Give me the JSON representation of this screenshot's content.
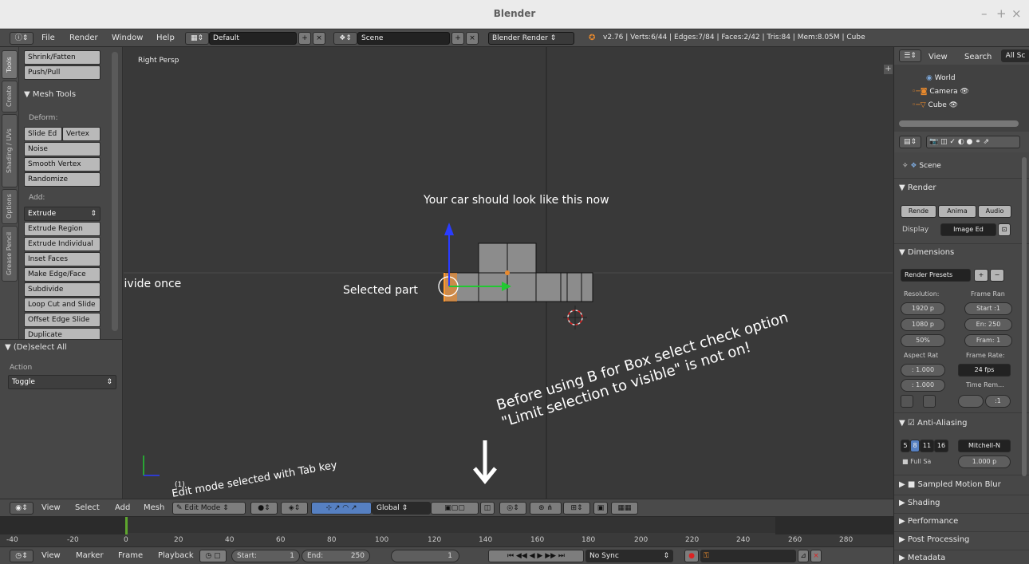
{
  "window": {
    "title": "Blender",
    "controls": [
      "–",
      "+",
      "×"
    ]
  },
  "infobar": {
    "menus": [
      "File",
      "Render",
      "Window",
      "Help"
    ],
    "layout": "Default",
    "scene": "Scene",
    "engine": "Blender Render",
    "stats": "v2.76 | Verts:6/44 | Edges:7/84 | Faces:2/42 | Tris:84 | Mem:8.05M | Cube"
  },
  "tabs": [
    "Tools",
    "Create",
    "Shading / UVs",
    "Options",
    "Grease Pencil"
  ],
  "toolshelf": {
    "top_buttons": [
      "Shrink/Fatten",
      "Push/Pull"
    ],
    "panel_title": "Mesh Tools",
    "deform_label": "Deform:",
    "slide_edge": "Slide Ed",
    "vertex": "Vertex",
    "deform_buttons": [
      "Noise",
      "Smooth Vertex",
      "Randomize"
    ],
    "add_label": "Add:",
    "extrude": "Extrude",
    "add_buttons": [
      "Extrude Region",
      "Extrude Individual",
      "Inset Faces",
      "Make Edge/Face",
      "Subdivide",
      "Loop Cut and Slide",
      "Offset Edge Slide",
      "Duplicate"
    ]
  },
  "operator": {
    "title": "(De)select All",
    "action_label": "Action",
    "action_value": "Toggle"
  },
  "viewport": {
    "view_label": "Right Persp",
    "annotation_main": "Your car should look like this now",
    "annotation_selected": "Selected part",
    "annotation_subdivide": "Subdivide once",
    "annotation_box_select": "Before using B for Box select check option\n\"Limit selection to visible\" is not on!",
    "annotation_edit_mode": "Edit mode selected with Tab key",
    "arrow_glyph": "↓",
    "object_label": "(1)"
  },
  "outliner": {
    "view": "View",
    "search": "Search",
    "filter": "All Sc",
    "items": [
      "World",
      "Camera",
      "Cube"
    ]
  },
  "properties": {
    "scene": "Scene",
    "render_section": "Render",
    "render_buttons": [
      "Rende",
      "Anima",
      "Audio"
    ],
    "display_label": "Display",
    "display_value": "Image Ed",
    "dimensions_section": "Dimensions",
    "render_presets": "Render Presets",
    "resolution_label": "Resolution:",
    "frame_range_label": "Frame Ran",
    "res_x": "1920 p",
    "res_y": "1080 p",
    "res_pct": "50%",
    "start": "Start :1",
    "end": "En: 250",
    "frame": "Fram: 1",
    "aspect_label": "Aspect Rat",
    "frame_rate_label": "Frame Rate:",
    "aspect_x": ": 1.000",
    "aspect_y": ": 1.000",
    "fps": "24 fps",
    "time_remap": "Time Rem...",
    "remap_a": "",
    "remap_b": ":1",
    "aa_section": "Anti-Aliasing",
    "aa_samples": [
      "5",
      "8",
      "11",
      "16"
    ],
    "aa_filter": "Mitchell-N",
    "full_sample": "Full Sa",
    "aa_size": "1.000 p",
    "sections_collapsed": [
      "Sampled Motion Blur",
      "Shading",
      "Performance",
      "Post Processing",
      "Metadata"
    ]
  },
  "view3d_header": {
    "menus": [
      "View",
      "Select",
      "Add",
      "Mesh"
    ],
    "mode": "Edit Mode",
    "orientation": "Global"
  },
  "timeline": {
    "ticks": [
      "-40",
      "-20",
      "0",
      "20",
      "40",
      "60",
      "80",
      "100",
      "120",
      "140",
      "160",
      "180",
      "200",
      "220",
      "240",
      "260",
      "280"
    ]
  },
  "timeline_header": {
    "menus": [
      "View",
      "Marker",
      "Frame",
      "Playback"
    ],
    "start_label": "Start:",
    "start_value": "1",
    "end_label": "End:",
    "end_value": "250",
    "current": "1",
    "sync": "No Sync"
  },
  "colors": {
    "accent": "#5680c2",
    "selected": "#e8892d",
    "grid_axis_green": "#5ea62e",
    "background": "#393939"
  }
}
